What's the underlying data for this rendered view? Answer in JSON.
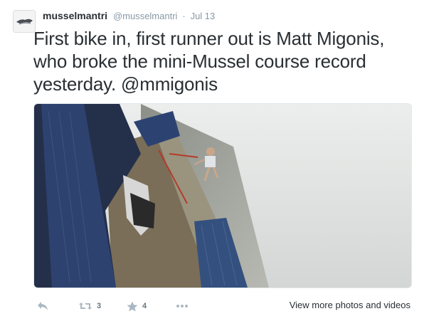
{
  "tweet": {
    "username": "musselmantri",
    "handle": "@musselmantri",
    "separator": "·",
    "time": "Jul 13",
    "text": "First bike in, first runner out is Matt Migonis, who broke the mini-Mussel course record yesterday. @mmigonis"
  },
  "media": {
    "description_icon": "photo"
  },
  "actions": {
    "reply_icon": "reply-icon",
    "retweet_icon": "retweet-icon",
    "retweet_count": "3",
    "favorite_icon": "star-icon",
    "favorite_count": "4",
    "more_icon": "more-icon",
    "view_more_label": "View more photos and videos"
  },
  "colors": {
    "text": "#292f33",
    "muted": "#8899a6",
    "border": "#e1e8ed"
  }
}
